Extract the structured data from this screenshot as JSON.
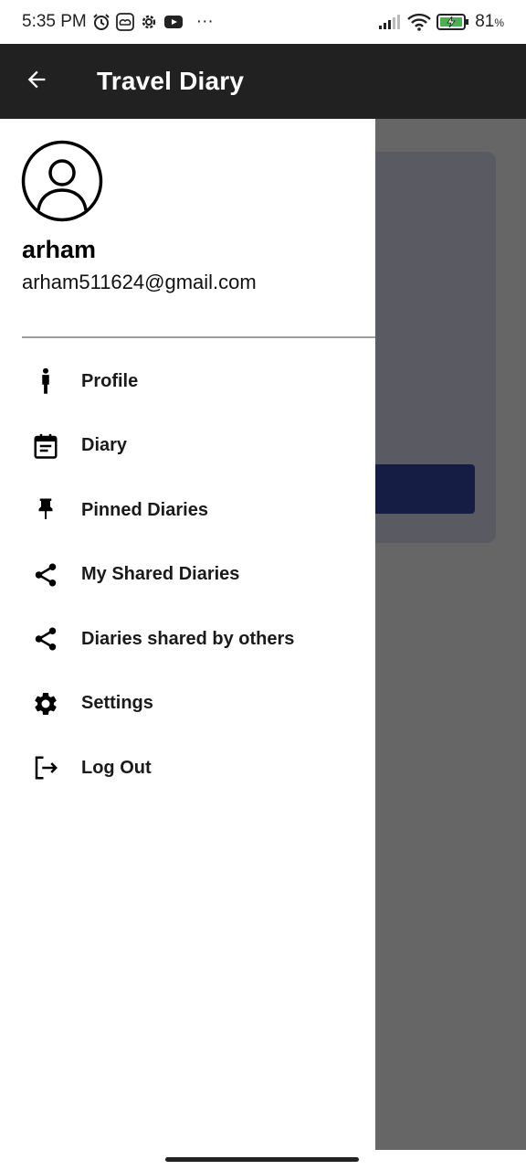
{
  "status_bar": {
    "time": "5:35 PM",
    "more": "···",
    "battery": "81",
    "battery_unit": "%",
    "icons": [
      "alarm-icon",
      "cloud-icon",
      "settings-gear-icon",
      "youtube-icon",
      "signal-icon",
      "wifi-icon",
      "battery-charging-icon"
    ]
  },
  "app_bar": {
    "title": "Travel Diary",
    "back_icon": "arrow-back-icon"
  },
  "drawer": {
    "user_name": "arham",
    "user_email": "arham511624@gmail.com",
    "avatar_icon": "account-circle-icon",
    "menu": [
      {
        "label": "Profile",
        "icon": "person-icon"
      },
      {
        "label": "Diary",
        "icon": "calendar-icon"
      },
      {
        "label": "Pinned Diaries",
        "icon": "pin-icon"
      },
      {
        "label": "My Shared Diaries",
        "icon": "share-icon"
      },
      {
        "label": "Diaries shared by others",
        "icon": "share-icon"
      },
      {
        "label": "Settings",
        "icon": "gear-icon"
      },
      {
        "label": "Log Out",
        "icon": "logout-icon"
      }
    ]
  },
  "colors": {
    "app_bar": "#212121",
    "scrim": "#666666",
    "drawer": "#ffffff"
  }
}
